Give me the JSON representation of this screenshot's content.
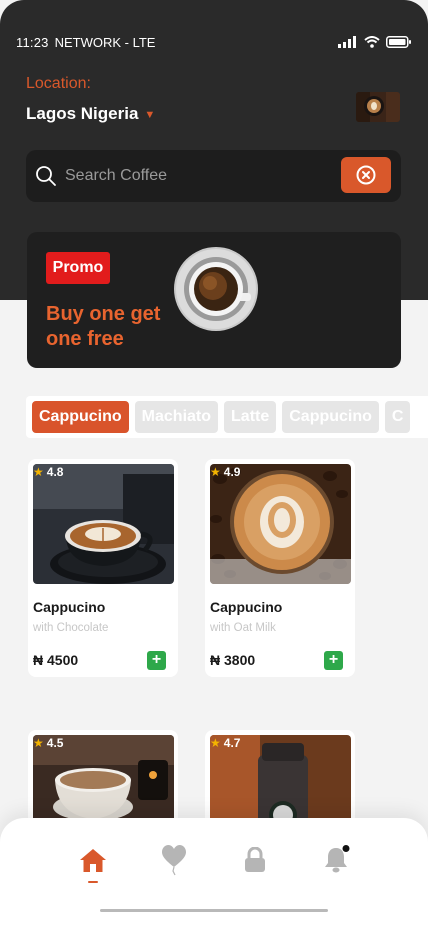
{
  "status": {
    "time": "11:23",
    "network": "NETWORK - LTE"
  },
  "location": {
    "label": "Location:",
    "value": "Lagos Nigeria"
  },
  "search": {
    "placeholder": "Search Coffee"
  },
  "promo": {
    "badge": "Promo",
    "headline": "Buy one get one free"
  },
  "categories": [
    "Cappucino",
    "Machiato",
    "Latte",
    "Cappucino",
    "C"
  ],
  "products": [
    {
      "rating": "4.8",
      "name": "Cappucino",
      "desc": "with Chocolate",
      "price": "₦ 4500"
    },
    {
      "rating": "4.9",
      "name": "Cappucino",
      "desc": "with Oat Milk",
      "price": "₦ 3800"
    },
    {
      "rating": "4.5",
      "name": "",
      "desc": "",
      "price": ""
    },
    {
      "rating": "4.7",
      "name": "",
      "desc": "",
      "price": ""
    }
  ],
  "nav": [
    "home-icon",
    "heart-icon",
    "lock-icon",
    "bell-icon"
  ],
  "colors": {
    "accent": "#d9582b",
    "dark": "#2a2a2a",
    "promo_red": "#e21c1c",
    "add_green": "#2ea84a"
  }
}
